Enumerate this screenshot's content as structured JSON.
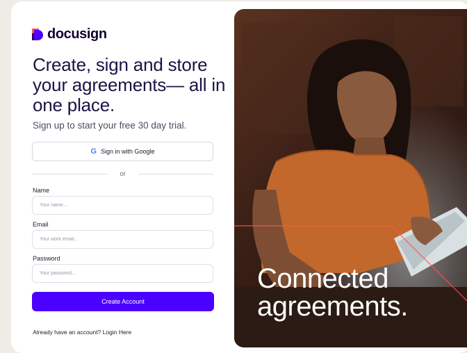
{
  "brand": {
    "name": "docusign"
  },
  "headline": "Create, sign and store your agreements— all in one place.",
  "subhead": "Sign up to start your free 30 day trial.",
  "google_button": {
    "icon": "G",
    "label": "Sign in with Google"
  },
  "divider_text": "or",
  "form": {
    "name": {
      "label": "Name",
      "placeholder": "Your name..."
    },
    "email": {
      "label": "Email",
      "placeholder": "Your work email..."
    },
    "password": {
      "label": "Password",
      "placeholder": "Your password..."
    },
    "submit_label": "Create Account"
  },
  "login_prompt": {
    "text": "Already have an account? ",
    "link": "Login Here"
  },
  "hero": {
    "line1": "Connected",
    "line2": "agreements."
  },
  "colors": {
    "accent": "#4c00ff",
    "logo_red": "#ff5252",
    "text_dark": "#130032"
  }
}
